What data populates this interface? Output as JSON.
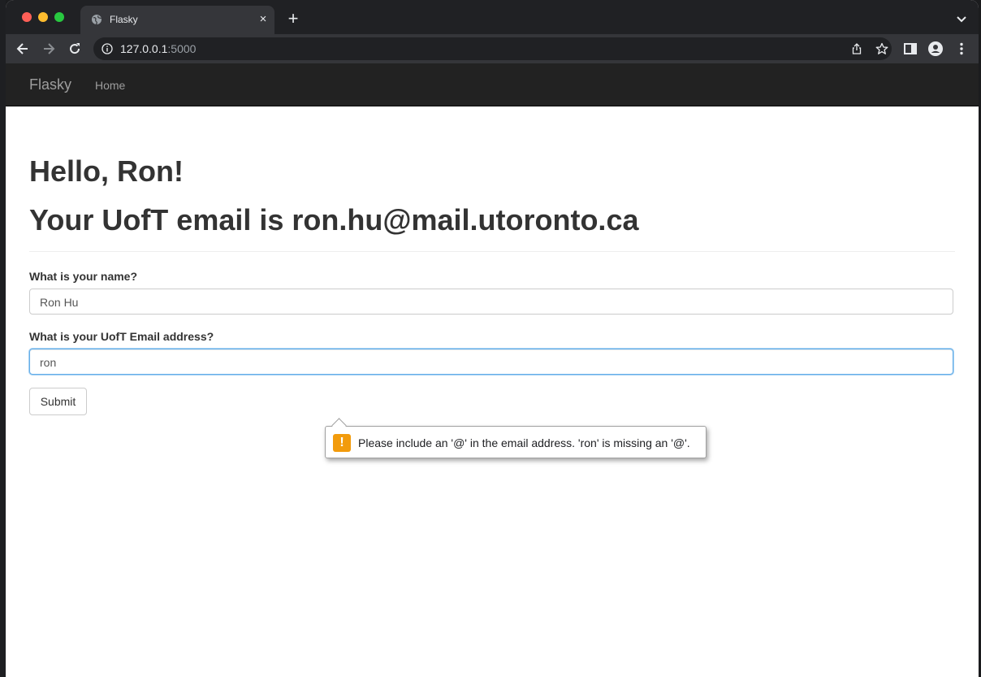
{
  "browser": {
    "tab_title": "Flasky",
    "new_tab": "+",
    "close_tab": "×",
    "url_host": "127.0.0.1",
    "url_port": ":5000"
  },
  "navbar": {
    "brand": "Flasky",
    "home": "Home"
  },
  "main": {
    "greeting": "Hello, Ron!",
    "email_line": "Your UofT email is ron.hu@mail.utoronto.ca"
  },
  "form": {
    "name_label": "What is your name?",
    "name_value": "Ron Hu",
    "email_label": "What is your UofT Email address?",
    "email_value": "ron",
    "submit_label": "Submit"
  },
  "validation": {
    "icon_text": "!",
    "message": "Please include an '@' in the email address. 'ron' is missing an '@'."
  },
  "colors": {
    "navbar_bg": "#222222",
    "warning_icon": "#f29b0c",
    "focus_border": "#66afe9"
  },
  "icons": [
    "globe-icon",
    "close-icon",
    "plus-icon",
    "chevron-down-icon",
    "back-arrow-icon",
    "forward-arrow-icon",
    "reload-icon",
    "info-icon",
    "share-icon",
    "star-icon",
    "sidebar-icon",
    "profile-icon",
    "kebab-menu-icon",
    "warning-icon"
  ]
}
